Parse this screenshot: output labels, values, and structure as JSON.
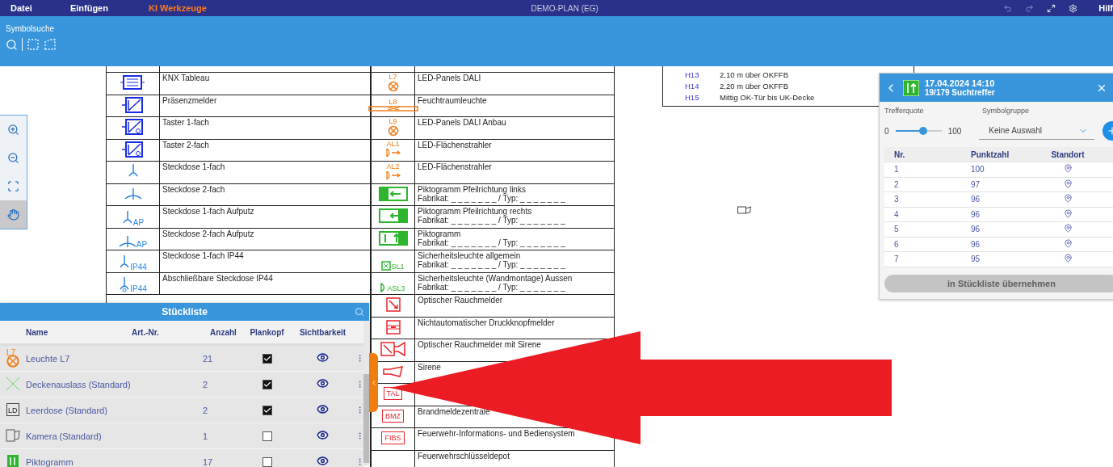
{
  "menu": [
    {
      "label": "Datei",
      "selected": false
    },
    {
      "label": "Einfügen",
      "selected": false
    },
    {
      "label": "KI Werkzeuge",
      "selected": true
    }
  ],
  "title": "DEMO-PLAN (EG)",
  "help": "Hilf",
  "toolbar": {
    "title": "Symbolsuche"
  },
  "tools": [
    {
      "kind": "zoomin",
      "selected": false
    },
    {
      "kind": "zoomout",
      "selected": false
    },
    {
      "kind": "fit",
      "selected": false
    },
    {
      "kind": "hand",
      "selected": true
    }
  ],
  "legend_left": [
    {
      "kind": "knx",
      "text": "KNX Tableau"
    },
    {
      "kind": "sensor",
      "text": "Präsenzmelder"
    },
    {
      "kind": "switch",
      "text": "Taster 1-fach"
    },
    {
      "kind": "switch",
      "text": "Taster 2-fach"
    },
    {
      "kind": "socket",
      "text": "Steckdose 1-fach"
    },
    {
      "kind": "socket2",
      "text": "Steckdose 2-fach"
    },
    {
      "kind": "socket",
      "label": "AP",
      "text": "Steckdose 1-fach Aufputz"
    },
    {
      "kind": "socket2",
      "label": "AP",
      "text": "Steckdose 2-fach Aufputz"
    },
    {
      "kind": "socket",
      "label": "IP44",
      "text": "Steckdose 1-fach IP44"
    },
    {
      "kind": "lock",
      "label": "IP44",
      "text": "Abschließbare Steckdose IP44"
    }
  ],
  "legend_middle": [
    {
      "kind": "lamp",
      "label": "L7",
      "text": "LED-Panels DALI"
    },
    {
      "kind": "bar",
      "label": "L8",
      "text": "Feuchtraumleuchte"
    },
    {
      "kind": "lamp",
      "label": "L9",
      "text": "LED-Panels DALI Anbau"
    },
    {
      "kind": "spot",
      "label": "AL1",
      "text": "LED-Flächenstrahler"
    },
    {
      "kind": "spot",
      "label": "AL2",
      "text": "LED-Flächenstrahler"
    },
    {
      "kind": "exitleft",
      "text": "Piktogramm Pfeilrichtung links",
      "subtext": "Fabrikat: _ _ _ _ _ _ _ / Typ: _ _ _ _ _ _ _"
    },
    {
      "kind": "exitright",
      "text": "Piktogramm Pfeilrichtung rechts",
      "subtext": "Fabrikat: _ _ _ _ _ _ _ / Typ: _ _ _ _ _ _ _"
    },
    {
      "kind": "exitup",
      "text": "Piktogramm",
      "subtext": "Fabrikat: _ _ _ _ _ _ _ / Typ: _ _ _ _ _ _ _"
    },
    {
      "kind": "safety",
      "label": "SL1",
      "text": "Sicherheitsleuchte allgemein",
      "subtext": "Fabrikat: _ _ _ _ _ _ _ / Typ: _ _ _ _ _ _ _"
    },
    {
      "kind": "safetywall",
      "label": "ASL3",
      "text": "Sicherheitsleuchte (Wandmontage) Aussen",
      "subtext": "Fabrikat: _ _ _ _ _ _ _ / Typ: _ _ _ _ _ _ _"
    },
    {
      "kind": "smoke",
      "text": "Optischer Rauchmelder"
    },
    {
      "kind": "pushbutton",
      "text": "Nichtautomatischer Druckknopfmelder"
    },
    {
      "kind": "smokesiren",
      "text": "Optischer Rauchmelder mit Sirene"
    },
    {
      "kind": "siren",
      "text": "Sirene"
    },
    {
      "kind": "boxed",
      "label": "TAL"
    },
    {
      "kind": "boxed",
      "label": "BMZ",
      "text": "Brandmeldezentrale"
    },
    {
      "kind": "boxed",
      "label": "FIBS",
      "text": "Feuerwehr-Informations- und Bediensystem"
    },
    {
      "kind": "none",
      "text": "Feuerwehrschlüsseldepot"
    }
  ],
  "heights": [
    {
      "code": "H13",
      "text": "2,10 m über OKFFB"
    },
    {
      "code": "H14",
      "text": "2,20 m über OKFFB"
    },
    {
      "code": "H15",
      "text": "Mittig OK-Tür bis UK-Decke"
    }
  ],
  "search_panel": {
    "timestamp": "17.04.2024 14:10",
    "hits": "19/179 Suchtreffer",
    "quote_label": "Trefferquote",
    "group_label": "Symbolgruppe",
    "slider": {
      "min": "0",
      "max": "100",
      "level": 0.6
    },
    "group_value": "Keine Auswahl",
    "columns": [
      "Nr.",
      "Punktzahl",
      "Standort"
    ],
    "rows": [
      {
        "nr": "1",
        "score": "100"
      },
      {
        "nr": "2",
        "score": "97"
      },
      {
        "nr": "3",
        "score": "96"
      },
      {
        "nr": "4",
        "score": "96"
      },
      {
        "nr": "5",
        "score": "96"
      },
      {
        "nr": "6",
        "score": "96"
      },
      {
        "nr": "7",
        "score": "95"
      }
    ],
    "action": {
      "label": "in Stückliste übernehmen",
      "disabled": true
    }
  },
  "parts_list": {
    "title": "Stückliste",
    "columns": [
      "Name",
      "Art.-Nr.",
      "Anzahl",
      "Plankopf",
      "Sichtbarkeit"
    ],
    "rows": [
      {
        "kind": "lamp",
        "icon_text": "L7",
        "name": "Leuchte L7",
        "count": "21",
        "checked": true,
        "visible": true
      },
      {
        "kind": "cross",
        "name": "Deckenauslass (Standard)",
        "count": "2",
        "checked": true,
        "visible": true
      },
      {
        "kind": "box",
        "icon_text": "LD",
        "name": "Leerdose (Standard)",
        "count": "2",
        "checked": true,
        "visible": true
      },
      {
        "kind": "camera",
        "name": "Kamera (Standard)",
        "count": "1",
        "checked": false,
        "visible": true
      },
      {
        "kind": "exit",
        "name": "Piktogramm",
        "count": "17",
        "checked": false,
        "visible": true
      }
    ]
  }
}
